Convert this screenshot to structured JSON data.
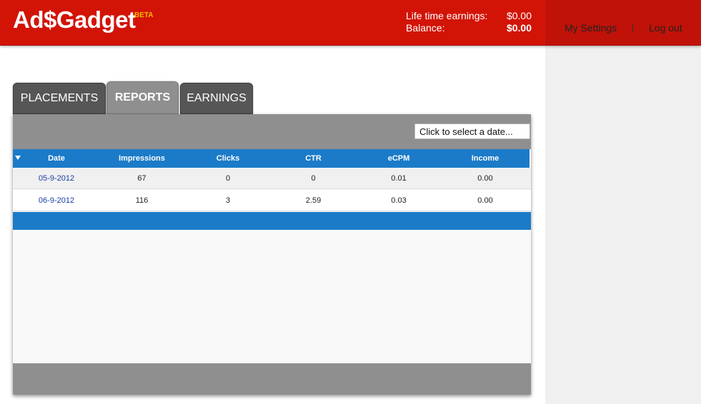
{
  "header": {
    "logo": "Ad$Gadget",
    "logo_badge": "BETA",
    "lifetime_label": "Life time earnings:",
    "lifetime_value": "$0.00",
    "balance_label": "Balance:",
    "balance_value": "$0.00",
    "settings_link": "My Settings",
    "separator": "|",
    "logout_link": "Log out",
    "brand_color": "#d21407"
  },
  "tabs": [
    {
      "label": "PLACEMENTS",
      "active": false
    },
    {
      "label": "REPORTS",
      "active": true
    },
    {
      "label": "EARNINGS",
      "active": false
    }
  ],
  "report": {
    "date_picker_placeholder": "Click to select a date...",
    "sort_icon": "triangle-down-icon",
    "accent_color": "#1b7bc8",
    "columns": [
      "Date",
      "Impressions",
      "Clicks",
      "CTR",
      "eCPM",
      "Income"
    ],
    "rows": [
      {
        "date": "05-9-2012",
        "impressions": "67",
        "clicks": "0",
        "ctr": "0",
        "ecpm": "0.01",
        "income": "0.00"
      },
      {
        "date": "06-9-2012",
        "impressions": "116",
        "clicks": "3",
        "ctr": "2.59",
        "ecpm": "0.03",
        "income": "0.00"
      }
    ]
  }
}
